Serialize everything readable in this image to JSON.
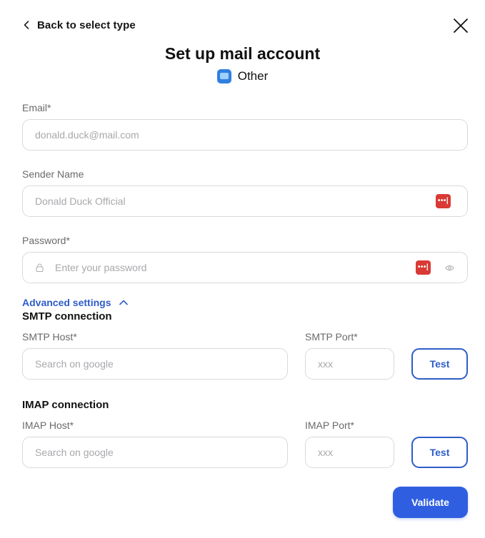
{
  "header": {
    "back_label": "Back to select type",
    "title": "Set up mail account",
    "provider": "Other"
  },
  "email": {
    "label": "Email*",
    "placeholder": "donald.duck@mail.com"
  },
  "sender": {
    "label": "Sender Name",
    "placeholder": "Donald Duck Official"
  },
  "password": {
    "label": "Password*",
    "placeholder": "Enter your password"
  },
  "advanced": {
    "label": "Advanced settings",
    "expanded": true
  },
  "smtp": {
    "section_title": "SMTP connection",
    "host_label": "SMTP Host*",
    "host_placeholder": "Search on google",
    "port_label": "SMTP Port*",
    "port_placeholder": "xxx",
    "test_label": "Test"
  },
  "imap": {
    "section_title": "IMAP connection",
    "host_label": "IMAP Host*",
    "host_placeholder": "Search on google",
    "port_label": "IMAP Port*",
    "port_placeholder": "xxx",
    "test_label": "Test"
  },
  "actions": {
    "validate_label": "Validate"
  },
  "colors": {
    "accent": "#2f5fe0",
    "link": "#2e5dc8",
    "password_manager": "#d93a35",
    "provider_icon": "#2f7fe0"
  },
  "icons": {
    "back": "chevron-left-icon",
    "close": "close-icon",
    "provider": "mail-app-icon",
    "password_manager": "password-manager-icon",
    "lock": "lock-icon",
    "show_password": "eye-icon",
    "advanced_toggle": "chevron-up-icon"
  }
}
